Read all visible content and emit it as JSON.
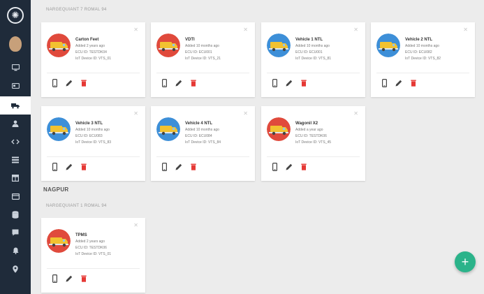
{
  "colors": {
    "sidebar": "#1f2b3a",
    "accent": "#2bb38a",
    "delete": "#e53935",
    "avatar_red": "#e04a3c",
    "avatar_blue": "#3d8fd8"
  },
  "sidebar": {
    "items": [
      {
        "icon": "logo-icon"
      },
      {
        "icon": "user-avatar-icon"
      },
      {
        "icon": "monitor-icon"
      },
      {
        "icon": "card-icon"
      },
      {
        "icon": "truck-icon"
      },
      {
        "icon": "person-icon"
      },
      {
        "icon": "code-icon"
      },
      {
        "icon": "list-icon"
      },
      {
        "icon": "table-icon"
      },
      {
        "icon": "window-icon"
      },
      {
        "icon": "database-icon"
      },
      {
        "icon": "chat-icon"
      },
      {
        "icon": "bell-icon"
      },
      {
        "icon": "location-icon"
      }
    ]
  },
  "sections": [
    {
      "title": "",
      "subtitle": "NARGEQUIANT 7 ROMAL 94",
      "cards": [
        {
          "name": "Carton Feet",
          "added": "Added 2 years ago",
          "ecu": "ECU ID: TESTDK04",
          "iot": "IoT Device ID: VTS_01",
          "avatar": "red"
        },
        {
          "name": "VDTI",
          "added": "Added 10 months ago",
          "ecu": "ECU ID: ECU001",
          "iot": "IoT Device ID: VTS_21",
          "avatar": "red"
        },
        {
          "name": "Vehicle 1 NTL",
          "added": "Added 10 months ago",
          "ecu": "ECU ID: ECU001",
          "iot": "IoT Device ID: VTS_81",
          "avatar": "blue"
        },
        {
          "name": "Vehicle 2 NTL",
          "added": "Added 10 months ago",
          "ecu": "ECU ID: ECU082",
          "iot": "IoT Device ID: VTS_82",
          "avatar": "blue"
        },
        {
          "name": "Vehicle 3 NTL",
          "added": "Added 10 months ago",
          "ecu": "ECU ID: ECU083",
          "iot": "IoT Device ID: VTS_83",
          "avatar": "blue"
        },
        {
          "name": "Vehicle 4 NTL",
          "added": "Added 10 months ago",
          "ecu": "ECU ID: ECU084",
          "iot": "IoT Device ID: VTS_84",
          "avatar": "blue"
        },
        {
          "name": "Wagonil X2",
          "added": "Added a year ago",
          "ecu": "ECU ID: TESTDK06",
          "iot": "IoT Device ID: VTS_45",
          "avatar": "red"
        }
      ]
    },
    {
      "title": "NAGPUR",
      "subtitle": "NARGEQUIANT 1 ROMAL 94",
      "cards": [
        {
          "name": "TPMS",
          "added": "Added 2 years ago",
          "ecu": "ECU ID: TESTDK06",
          "iot": "IoT Device ID: VTS_01",
          "avatar": "red"
        }
      ]
    }
  ],
  "fab": {
    "label": "+"
  }
}
